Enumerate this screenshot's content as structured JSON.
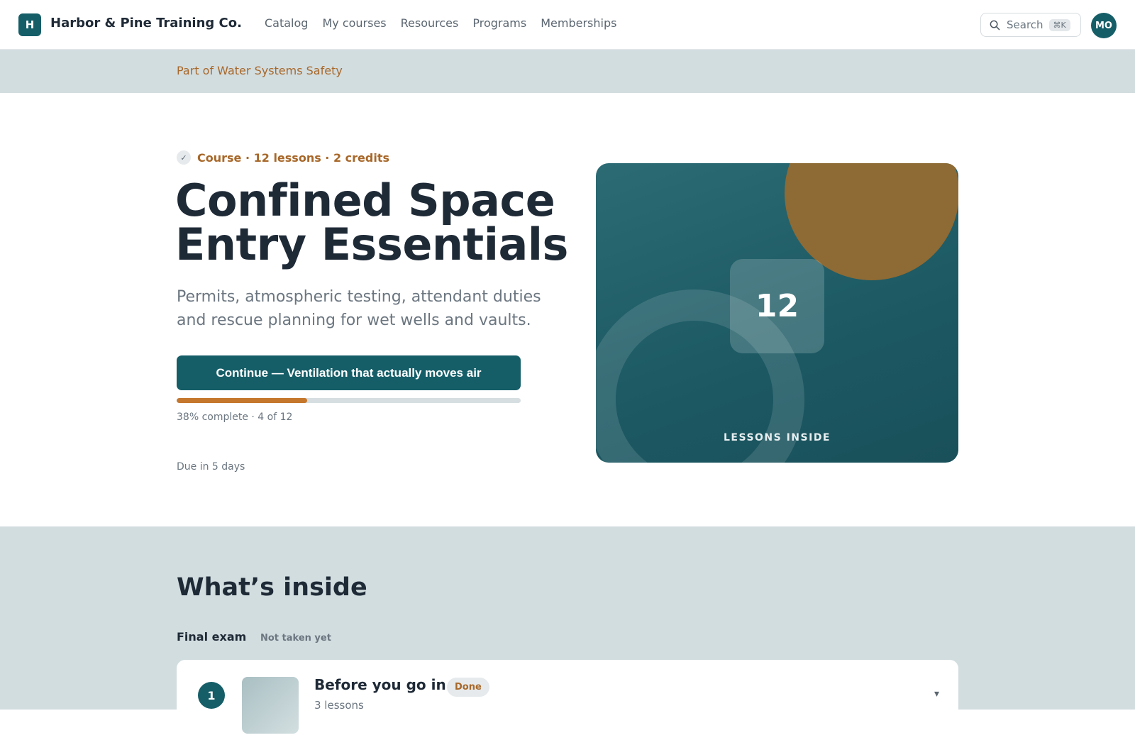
{
  "header": {
    "logo_letter": "H",
    "brand": "Harbor & Pine Training Co.",
    "nav": [
      "Catalog",
      "My courses",
      "Resources",
      "Programs",
      "Memberships"
    ],
    "search_label": "Search",
    "search_shortcut": "⌘K",
    "avatar_initials": "MO"
  },
  "breadcrumb": "Part of Water Systems Safety",
  "hero": {
    "meta_check": "✓",
    "meta": "Course · 12 lessons · 2 credits",
    "title": "Confined Space Entry Essentials",
    "subtitle": "Permits, atmospheric testing, attendant duties and rescue planning for wet wells and vaults.",
    "cta_label": "Continue — Ventilation that actually moves air",
    "progress_fraction": 0.38,
    "progress_text": "38% complete · 4 of 12",
    "due": "Due in 5 days"
  },
  "art": {
    "count": "12",
    "caption": "LESSONS INSIDE",
    "colors": {
      "base": "#1d5a64",
      "sun": "#8e6a34"
    }
  },
  "inside": {
    "heading": "What’s inside",
    "exam_label": "Final exam",
    "exam_status": "Not taken yet",
    "modules": [
      {
        "number": "1",
        "title": "Before you go in",
        "badge": "Done",
        "subtitle": "3 lessons"
      }
    ]
  },
  "colors": {
    "primary": "#155e68",
    "accent": "#a8682a",
    "progress": "#c5772c",
    "band": "#d2dde0"
  }
}
